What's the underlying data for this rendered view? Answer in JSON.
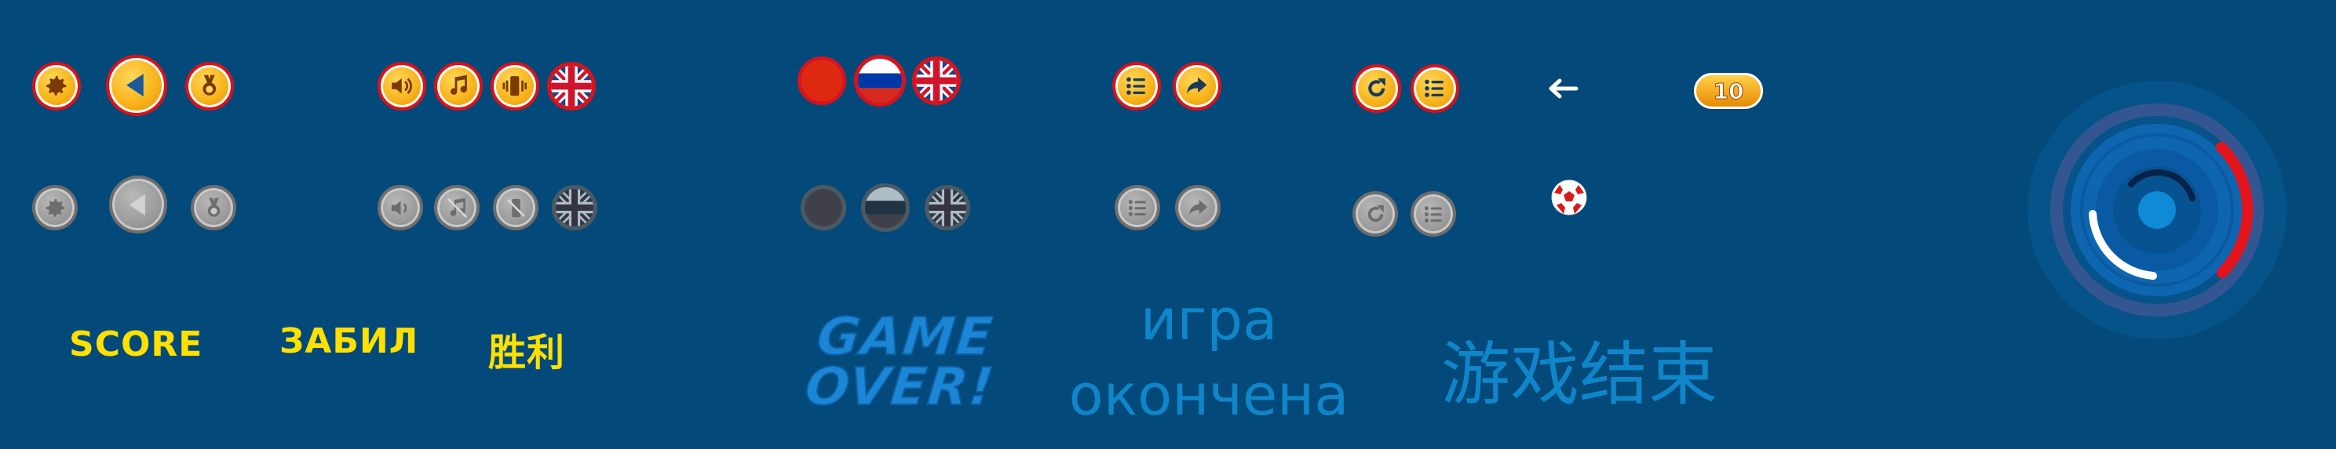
{
  "colors": {
    "background": "#03497a",
    "button_fill": "#f7b31a",
    "button_ring": "#d9121b",
    "inactive_fill": "#9a9a9a",
    "label_yellow": "#ffe000",
    "text_blue": "#0f86c9",
    "progress_red": "#e3141b"
  },
  "top_row": {
    "group1": [
      "gear-icon",
      "back-icon",
      "medal-icon"
    ],
    "group2": [
      "speaker-icon",
      "music-icon",
      "vibrate-icon",
      "flag-uk"
    ],
    "flags": [
      "flag-china",
      "flag-russia",
      "flag-uk"
    ],
    "group4": [
      "list-icon",
      "share-icon"
    ],
    "group5": [
      "restart-icon",
      "list-icon"
    ],
    "arrow_icon": "left-arrow-icon",
    "score_badge": "10"
  },
  "bottom_row_icons": "disabled variants of the buttons above",
  "ball_icon": "soccer-ball-icon",
  "labels": {
    "score_en": "SCORE",
    "score_ru": "ЗАБИЛ",
    "score_zh": "胜利"
  },
  "game_over": {
    "en_line1": "GAME",
    "en_line2": "OVER!",
    "ru_line1": "игра",
    "ru_line2": "окончена",
    "zh": "游戏结束"
  },
  "timer_ring": {
    "red_arc_fraction": 0.2,
    "white_arc_fraction": 0.2
  }
}
